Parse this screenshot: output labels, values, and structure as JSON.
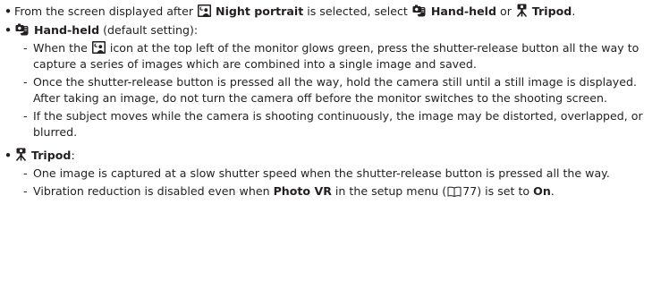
{
  "icons": {
    "night_portrait": "night-portrait-icon",
    "hand_held": "hand-held-icon",
    "tripod": "tripod-icon",
    "book": "book-reference-icon"
  },
  "bullet1": {
    "part1": "From the screen displayed after ",
    "night_portrait": "Night portrait",
    "part2": " is selected, select ",
    "hand_held": "Hand-held",
    "part3": " or ",
    "tripod": "Tripod",
    "part4": "."
  },
  "handheld": {
    "title": "Hand-held",
    "title_suffix": " (default setting):",
    "item1_pre": "When the ",
    "item1_post": " icon at the top left of the monitor glows green, press the shutter-release button all the way to capture a series of images which are combined into a single image and saved.",
    "item2": "Once the shutter-release button is pressed all the way, hold the camera still until a still image is displayed. After taking an image, do not turn the camera off before the monitor switches to the shooting screen.",
    "item3": "If the subject moves while the camera is shooting continuously, the image may be distorted, overlapped, or blurred."
  },
  "tripod": {
    "title": "Tripod",
    "title_suffix": ":",
    "item1": "One image is captured at a slow shutter speed when the shutter-release button is pressed all the way.",
    "item2_pre": "Vibration reduction is disabled even when ",
    "item2_bold": "Photo VR",
    "item2_mid": " in the setup menu (",
    "item2_page": "77",
    "item2_mid2": ") is set to ",
    "item2_on": "On",
    "item2_end": "."
  }
}
